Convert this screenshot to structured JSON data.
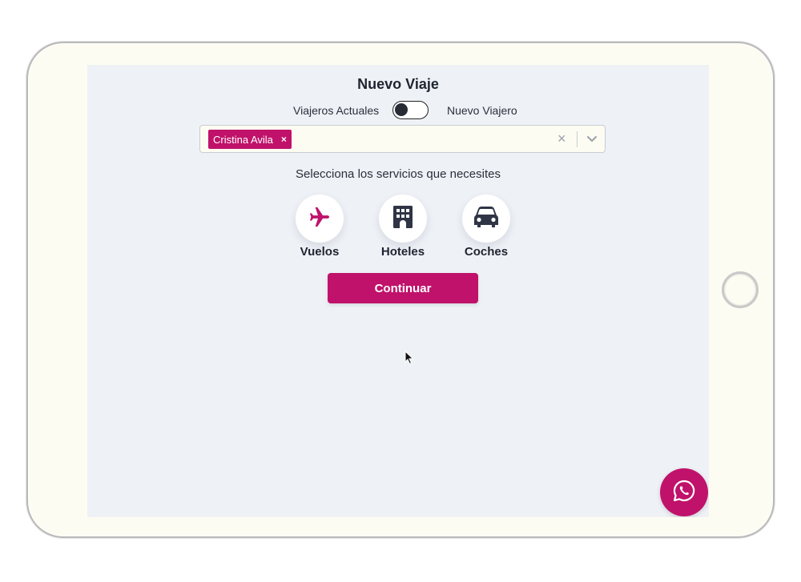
{
  "page": {
    "title": "Nuevo Viaje"
  },
  "traveler_toggle": {
    "left_label": "Viajeros Actuales",
    "right_label": "Nuevo Viajero",
    "state": "off"
  },
  "traveler_select": {
    "selected_chip": "Cristina Avila",
    "chip_remove": "×",
    "clear": "×"
  },
  "services": {
    "prompt": "Selecciona los servicios que necesites",
    "items": [
      {
        "label": "Vuelos",
        "icon": "plane-icon",
        "color": "#c0126a"
      },
      {
        "label": "Hoteles",
        "icon": "hotel-icon",
        "color": "#2f3545"
      },
      {
        "label": "Coches",
        "icon": "car-icon",
        "color": "#2f3545"
      }
    ]
  },
  "actions": {
    "continue_label": "Continuar"
  },
  "floating": {
    "icon": "whatsapp-icon"
  },
  "colors": {
    "accent": "#c0126a",
    "screen_bg": "#eef1f6",
    "text_dark": "#1f2430"
  }
}
